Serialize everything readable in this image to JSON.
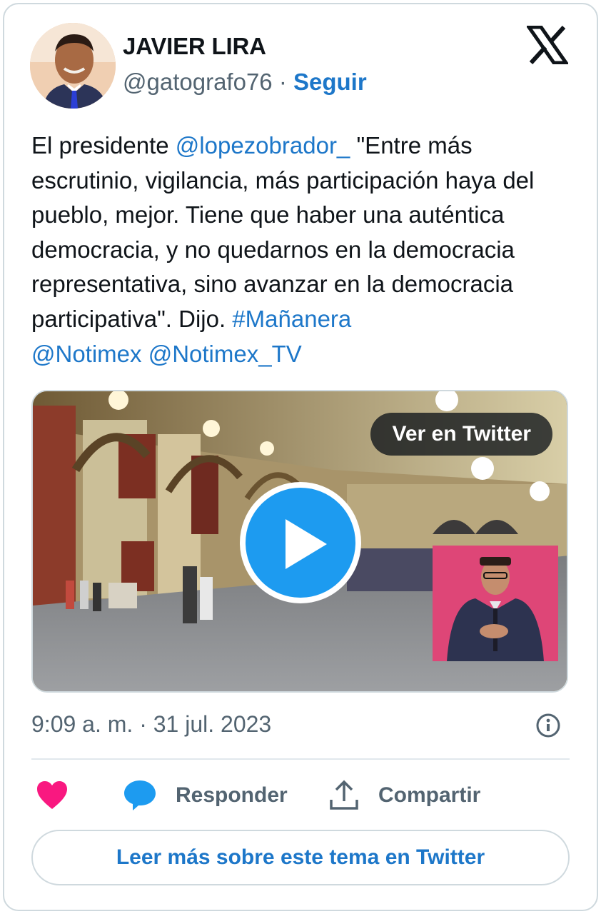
{
  "author": {
    "display_name": "JAVIER LIRA",
    "handle": "@gatografo76",
    "separator": "·",
    "follow_label": "Seguir"
  },
  "tweet": {
    "text_prefix": "El presidente ",
    "mention_1": "@lopezobrador_",
    "text_body": " \"Entre más escrutinio, vigilancia, más participación haya del pueblo, mejor. Tiene que haber una auténtica democracia, y no quedarnos en la democracia representativa, sino avanzar en la democracia participativa\". Dijo. ",
    "hashtag": "#Mañanera",
    "mention_2": "@Notimex",
    "mention_3": "@Notimex_TV"
  },
  "media": {
    "view_on_twitter_label": "Ver en Twitter"
  },
  "meta": {
    "timestamp": "9:09 a. m. · 31 jul. 2023"
  },
  "actions": {
    "reply_label": "Responder",
    "share_label": "Compartir"
  },
  "footer": {
    "read_more_label": "Leer más sobre este tema en Twitter"
  },
  "colors": {
    "link": "#1d77c9",
    "play_button": "#1d9bf0",
    "like": "#f91880",
    "interpreter_bg": "#de4677"
  },
  "icons": [
    "x-logo-icon",
    "play-icon",
    "info-icon",
    "heart-icon",
    "reply-bubble-icon",
    "share-upload-icon"
  ]
}
